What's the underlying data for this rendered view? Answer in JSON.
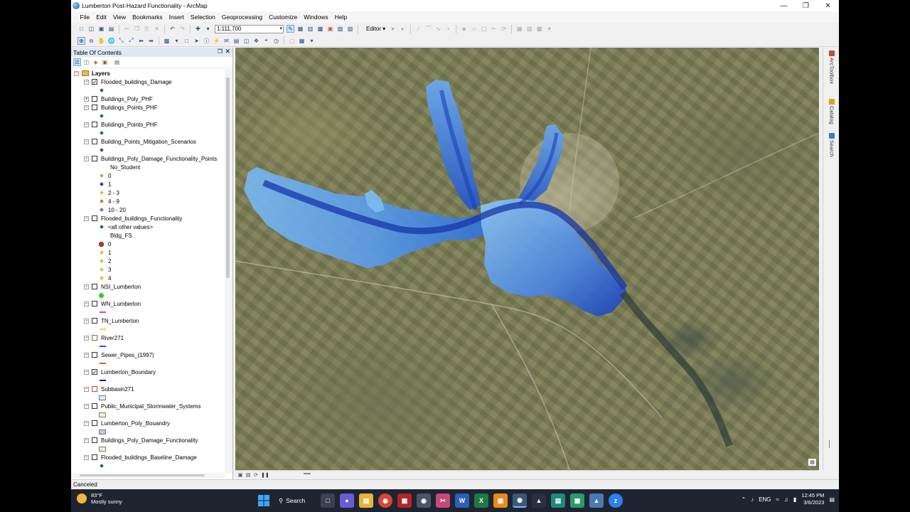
{
  "window": {
    "title": "Lumberton Post-Hazard Functionality - ArcMap",
    "minimize": "—",
    "maximize": "❐",
    "close": "✕"
  },
  "menu": [
    "File",
    "Edit",
    "View",
    "Bookmarks",
    "Insert",
    "Selection",
    "Geoprocessing",
    "Customize",
    "Windows",
    "Help"
  ],
  "toolbar": {
    "scale": "1:111,700",
    "editor_label": "Editor ▾"
  },
  "toc": {
    "title": "Table Of Contents",
    "pin": "❒",
    "close": "✕",
    "root": "Layers",
    "layers": [
      {
        "name": "Flooded_buildings_Damage",
        "checked": true,
        "expanded": true
      },
      {
        "name": "Buildings_Poly_PHF",
        "checked": false,
        "expanded": false
      },
      {
        "name": "Buildings_Points_PHF",
        "checked": false,
        "expanded": true
      },
      {
        "name": "Buildings_Points_PHF",
        "checked": false,
        "expanded": true
      },
      {
        "name": "Building_Points_Mitigation_Scenarios",
        "checked": false,
        "expanded": true
      },
      {
        "name": "Buildings_Poly_Damage_Functionality_Points",
        "checked": false,
        "expanded": true
      },
      {
        "name": "Flooded_buildings_Functionality",
        "checked": false,
        "expanded": true
      },
      {
        "name": "NSI_Lumberton",
        "checked": false,
        "expanded": true
      },
      {
        "name": "WN_Lumberton",
        "checked": false,
        "expanded": true
      },
      {
        "name": "TN_Lumberton",
        "checked": false,
        "expanded": true
      },
      {
        "name": "River271",
        "checked": false,
        "expanded": true
      },
      {
        "name": "Sewer_Pipes_(1997)",
        "checked": false,
        "expanded": true
      },
      {
        "name": "Lumberton_Boundary",
        "checked": true,
        "expanded": true
      },
      {
        "name": "Subbasin271",
        "checked": false,
        "expanded": true
      },
      {
        "name": "Public_Municipal_Stormwater_Systems",
        "checked": false,
        "expanded": true
      },
      {
        "name": "Lumberton_Poly_Bouandry",
        "checked": false,
        "expanded": true
      },
      {
        "name": "Buildings_Poly_Damage_Functionality",
        "checked": false,
        "expanded": true
      },
      {
        "name": "Flooded_buildings_Baseline_Damage",
        "checked": false,
        "expanded": true
      }
    ],
    "legend_student": {
      "field": "No_Student",
      "classes": [
        "0",
        "1",
        "2 - 3",
        "4 - 9",
        "10 - 20"
      ]
    },
    "legend_func": {
      "other": "<all other values>",
      "field": "Bldg_FS",
      "classes": [
        "0",
        "1",
        "2",
        "3",
        "4"
      ]
    },
    "colors": {
      "nsi": "#2ecc2e",
      "wn": "#d63ad1",
      "tn": "#cde34a",
      "river": "#1e5bd8",
      "sewer": "#e4572e",
      "boundary": "#1a1a8c"
    }
  },
  "dock_tabs": [
    "ArcToolbox",
    "Catalog",
    "Search"
  ],
  "status": "Canceled",
  "taskbar": {
    "temp": "83°F",
    "weather": "Mostly sunny",
    "search": "Search",
    "lang": "ENG",
    "time": "12:45 PM",
    "date": "3/6/2023"
  }
}
